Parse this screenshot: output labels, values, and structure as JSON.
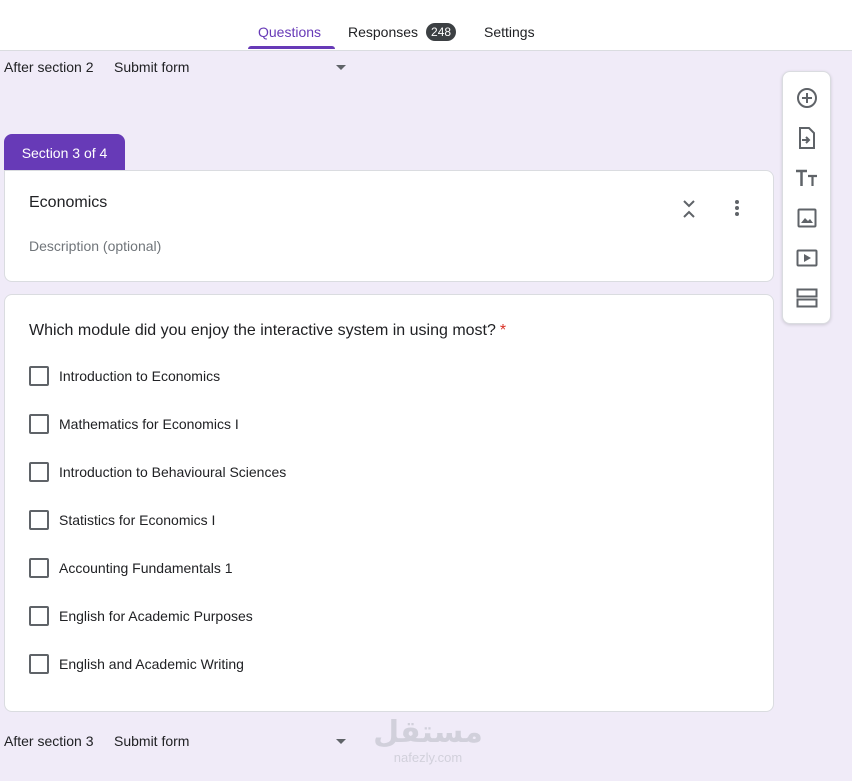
{
  "tabs": {
    "questions": "Questions",
    "responses": "Responses",
    "responses_count": "248",
    "settings": "Settings"
  },
  "after_section_2": {
    "label": "After section 2",
    "value": "Submit form"
  },
  "section_tag": "Section 3 of 4",
  "section_header": {
    "title": "Economics",
    "description_placeholder": "Description (optional)"
  },
  "question": {
    "text": "Which module did you enjoy the interactive system in using most?",
    "required_mark": "*",
    "options": [
      "Introduction to Economics",
      "Mathematics for Economics I",
      "Introduction to Behavioural Sciences",
      "Statistics for Economics I",
      "Accounting Fundamentals 1",
      "English for Academic Purposes",
      "English and Academic Writing"
    ]
  },
  "after_section_3": {
    "label": "After section 3",
    "value": "Submit form"
  },
  "toolbar": {
    "icons": [
      "add-question-icon",
      "import-questions-icon",
      "add-title-icon",
      "add-image-icon",
      "add-video-icon",
      "add-section-icon"
    ]
  },
  "watermark": {
    "line1": "مستقل",
    "line2": "nafezly.com"
  },
  "colors": {
    "accent": "#673ab7",
    "background": "#f0ebf8",
    "required": "#d93025"
  }
}
